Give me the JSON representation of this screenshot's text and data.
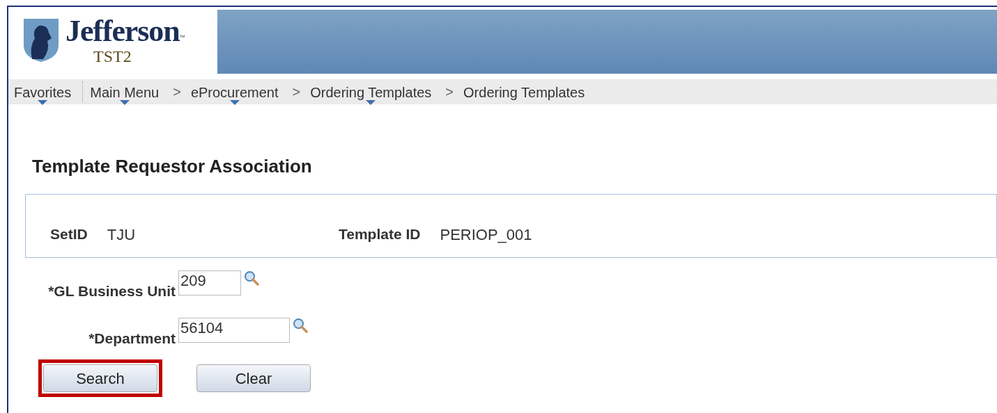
{
  "header": {
    "logo_name": "Jefferson",
    "logo_mark": "™",
    "environment": "TST2"
  },
  "nav": [
    {
      "kind": "menu",
      "label": "Favorites",
      "dropdown": true
    },
    {
      "kind": "divider"
    },
    {
      "kind": "menu",
      "label": "Main Menu",
      "dropdown": true
    },
    {
      "kind": "separator",
      "label": ">"
    },
    {
      "kind": "menu",
      "label": "eProcurement",
      "dropdown": true
    },
    {
      "kind": "separator",
      "label": ">"
    },
    {
      "kind": "menu",
      "label": "Ordering Templates",
      "dropdown": true
    },
    {
      "kind": "separator",
      "label": ">"
    },
    {
      "kind": "menu",
      "label": "Ordering Templates",
      "dropdown": false
    }
  ],
  "page_title": "Template Requestor Association",
  "info": [
    {
      "label": "SetID",
      "value": "TJU"
    },
    {
      "label": "Template ID",
      "value": "PERIOP_001"
    }
  ],
  "fields": [
    {
      "label": "*GL Business Unit",
      "value": "209"
    },
    {
      "label": "*Department",
      "value": "56104"
    }
  ],
  "buttons": [
    {
      "label": "Search",
      "highlighted": true
    },
    {
      "label": "Clear",
      "highlighted": false
    }
  ]
}
